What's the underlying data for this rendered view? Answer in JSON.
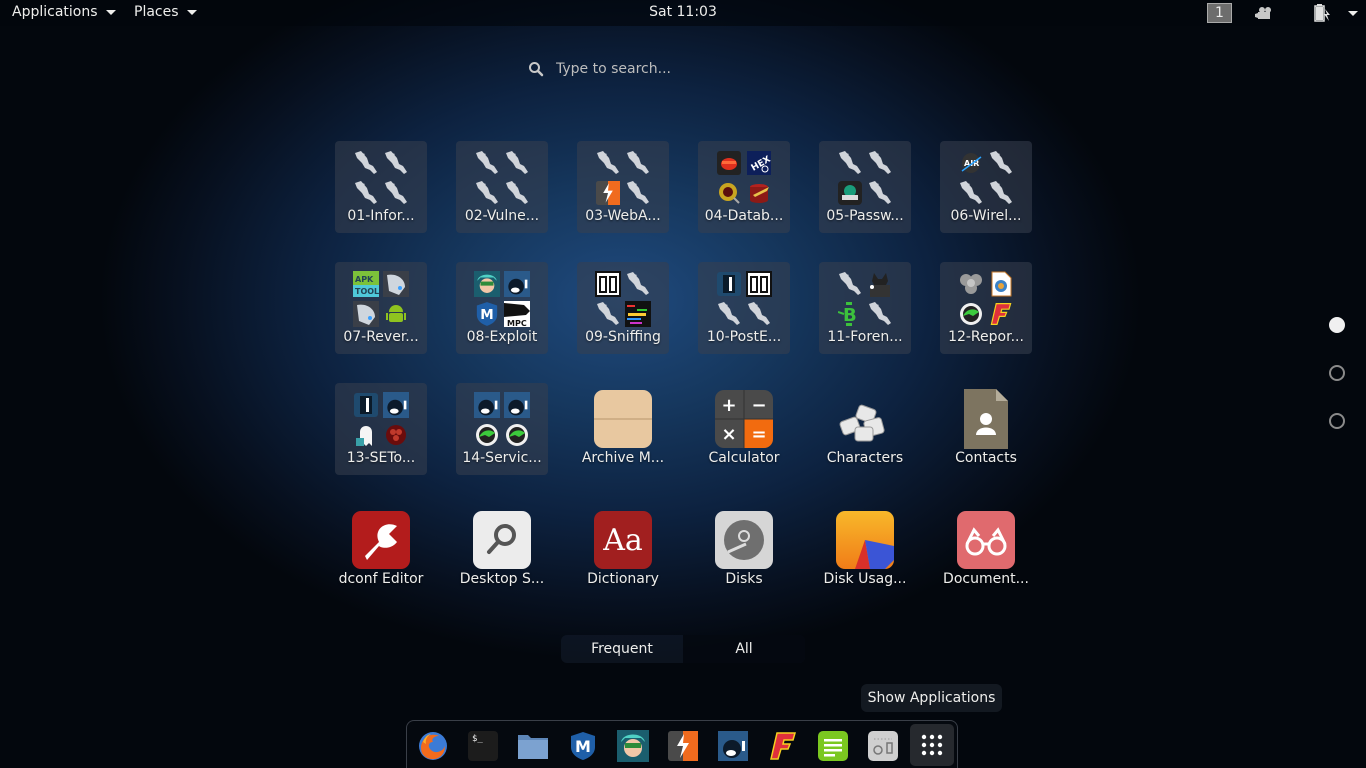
{
  "topbar": {
    "applications_label": "Applications",
    "places_label": "Places",
    "clock": "Sat 11:03",
    "workspace": "1",
    "icons": [
      "camera-icon",
      "battery-icon",
      "system-menu-caret"
    ]
  },
  "search": {
    "placeholder": "Type to search...",
    "value": ""
  },
  "apps": [
    {
      "label": "01-Infor...",
      "type": "folder",
      "icons": [
        "kali-dragon",
        "kali-dragon",
        "kali-dragon",
        "kali-dragon"
      ]
    },
    {
      "label": "02-Vulne...",
      "type": "folder",
      "icons": [
        "kali-dragon",
        "kali-dragon",
        "kali-dragon",
        "kali-dragon"
      ]
    },
    {
      "label": "03-WebA...",
      "type": "folder",
      "icons": [
        "kali-dragon",
        "kali-dragon",
        "burpsuite",
        "kali-dragon"
      ]
    },
    {
      "label": "04-Datab...",
      "type": "folder",
      "icons": [
        "jsql",
        "hexorbase",
        "oscanner",
        "sqlmap"
      ]
    },
    {
      "label": "05-Passw...",
      "type": "folder",
      "icons": [
        "kali-dragon",
        "kali-dragon",
        "hashcat",
        "kali-dragon"
      ]
    },
    {
      "label": "06-Wirel...",
      "type": "folder",
      "icons": [
        "aircrack",
        "kali-dragon",
        "kali-dragon",
        "kali-dragon"
      ]
    },
    {
      "label": "07-Rever...",
      "type": "folder",
      "icons": [
        "apktool",
        "edb-debugger",
        "edb-debugger",
        "android"
      ]
    },
    {
      "label": "08-Exploit",
      "type": "folder",
      "icons": [
        "armitage",
        "beef",
        "metasploit",
        "msf-rpc"
      ]
    },
    {
      "label": "09-Sniffing",
      "type": "folder",
      "icons": [
        "ettercap",
        "kali-dragon",
        "kali-dragon",
        "wireshark"
      ]
    },
    {
      "label": "10-PostE...",
      "type": "folder",
      "icons": [
        "backdoor",
        "ettercap",
        "kali-dragon",
        "kali-dragon"
      ]
    },
    {
      "label": "11-Foren...",
      "type": "folder",
      "icons": [
        "kali-dragon",
        "autopsy",
        "binwalk",
        "kali-dragon"
      ]
    },
    {
      "label": "12-Repor...",
      "type": "folder",
      "icons": [
        "cutycapt",
        "dradis",
        "faraday-green",
        "faraday"
      ]
    },
    {
      "label": "13-SETo...",
      "type": "folder",
      "icons": [
        "backdoor",
        "beef",
        "set-ghost",
        "set-red"
      ]
    },
    {
      "label": "14-Servic...",
      "type": "folder",
      "icons": [
        "beef",
        "beef",
        "faraday-green",
        "faraday-green"
      ]
    },
    {
      "label": "Archive M...",
      "type": "app",
      "icon": "archive-manager"
    },
    {
      "label": "Calculator",
      "type": "app",
      "icon": "calculator"
    },
    {
      "label": "Characters",
      "type": "app",
      "icon": "characters"
    },
    {
      "label": "Contacts",
      "type": "app",
      "icon": "contacts"
    },
    {
      "label": "dconf Editor",
      "type": "app",
      "icon": "dconf-editor"
    },
    {
      "label": "Desktop S...",
      "type": "app",
      "icon": "desktop-search"
    },
    {
      "label": "Dictionary",
      "type": "app",
      "icon": "dictionary"
    },
    {
      "label": "Disks",
      "type": "app",
      "icon": "disks"
    },
    {
      "label": "Disk Usag...",
      "type": "app",
      "icon": "disk-usage"
    },
    {
      "label": "Document...",
      "type": "app",
      "icon": "document-viewer"
    }
  ],
  "pages": {
    "count": 3,
    "active": 1
  },
  "view_switch": {
    "frequent_label": "Frequent",
    "all_label": "All",
    "active": "All"
  },
  "tooltip": "Show Applications",
  "dock": [
    {
      "name": "firefox",
      "icon": "firefox-icon"
    },
    {
      "name": "terminal",
      "icon": "terminal-icon",
      "glyph": "$_"
    },
    {
      "name": "files",
      "icon": "folder-icon"
    },
    {
      "name": "metasploit",
      "icon": "metasploit-icon",
      "glyph": "M"
    },
    {
      "name": "armitage",
      "icon": "armitage-icon"
    },
    {
      "name": "burpsuite",
      "icon": "burpsuite-icon"
    },
    {
      "name": "beef",
      "icon": "beef-icon"
    },
    {
      "name": "faraday",
      "icon": "faraday-icon",
      "glyph": "F"
    },
    {
      "name": "notes",
      "icon": "notes-icon"
    },
    {
      "name": "settings",
      "icon": "settings-icon"
    },
    {
      "name": "show-applications",
      "icon": "grid-icon"
    }
  ],
  "icon_glyphs": {
    "calculator": [
      "+",
      "−",
      "×",
      "="
    ],
    "dictionary": "Aa"
  }
}
